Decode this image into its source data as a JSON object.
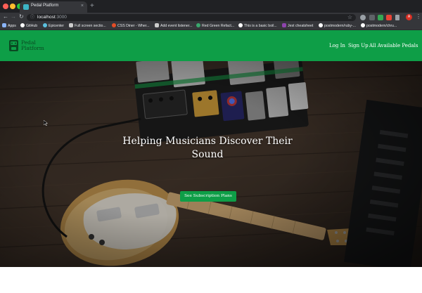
{
  "browser": {
    "tab_title": "Pedal Platform",
    "tab_close": "×",
    "new_tab": "+",
    "url_host": "localhost",
    "url_port": ":3000",
    "back": "←",
    "forward": "→",
    "reload": "↻",
    "info_icon": "ⓘ",
    "star_icon": "☆",
    "menu_icon": "⋮",
    "avatar_letter": "A",
    "bookmarks": [
      {
        "label": "Apps",
        "icon": "apps-grid-icon",
        "color": "#8ab4f8"
      },
      {
        "label": "GitHub",
        "icon": "github-icon",
        "color": "#ffffff"
      },
      {
        "label": "Epicenter",
        "icon": "epicenter-icon",
        "color": "#5bc0de"
      },
      {
        "label": "Full screen sectio...",
        "icon": "page-icon",
        "color": "#cccccc"
      },
      {
        "label": "CSS Diner - Wher...",
        "icon": "css-diner-icon",
        "color": "#e44d26"
      },
      {
        "label": "Add event listener...",
        "icon": "page-icon",
        "color": "#cccccc"
      },
      {
        "label": "Red Green Refact...",
        "icon": "rgr-icon",
        "color": "#3aa76d"
      },
      {
        "label": "This is a basic boil...",
        "icon": "github-icon",
        "color": "#ffffff"
      },
      {
        "label": "Jest cheatsheet",
        "icon": "jest-icon",
        "color": "#8e44ad"
      },
      {
        "label": "postmodern/ruby-...",
        "icon": "github-icon",
        "color": "#ffffff"
      },
      {
        "label": "postmodern/chru...",
        "icon": "github-icon",
        "color": "#ffffff"
      }
    ]
  },
  "site": {
    "brand_line1": "Pedal",
    "brand_line2": "Platform",
    "nav": {
      "login": "Log In",
      "signup": "Sign Up",
      "pedals": "All Available Pedals"
    },
    "hero": {
      "title_line1": "Helping Musicians Discover Their",
      "title_line2": "Sound",
      "cta": "See Subscription Plans"
    }
  },
  "colors": {
    "brand_green": "#0e9e47",
    "chrome_dark": "#202124",
    "chrome_mid": "#35363a"
  }
}
